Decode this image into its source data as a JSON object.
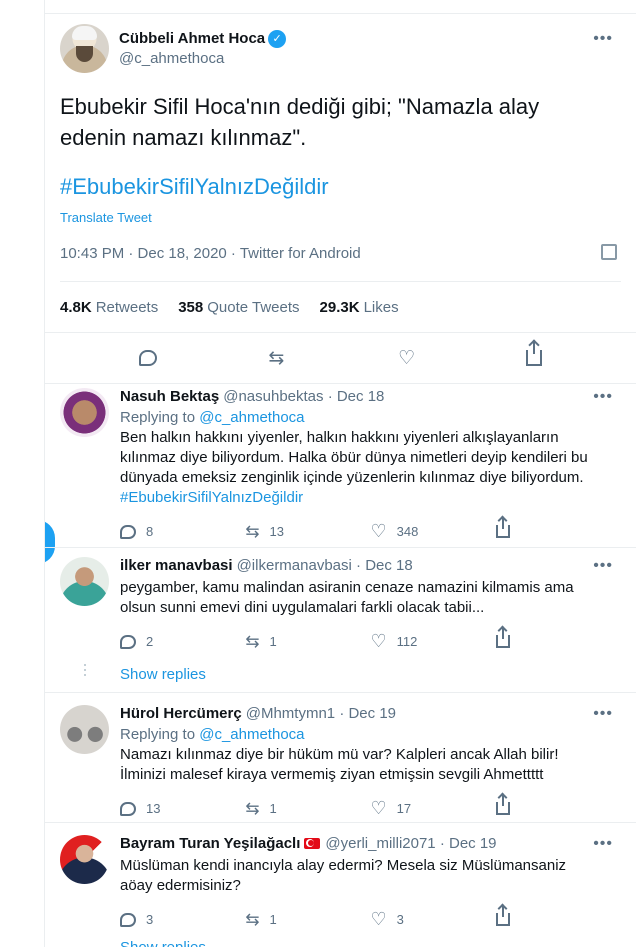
{
  "main_tweet": {
    "author_name": "Cübbeli Ahmet Hoca",
    "author_handle": "@c_ahmethoca",
    "text": "Ebubekir Sifil Hoca'nın dediği gibi; \"Namazla alay edenin namazı kılınmaz\".",
    "hashtag": "#EbubekirSifilYalnızDeğildir",
    "translate": "Translate Tweet",
    "meta": "10:43 PM · Dec 18, 2020 · Twitter for Android",
    "stats": {
      "retweets_count": "4.8K",
      "retweets_label": "Retweets",
      "quotes_count": "358",
      "quotes_label": "Quote Tweets",
      "likes_count": "29.3K",
      "likes_label": "Likes"
    }
  },
  "replies": [
    {
      "name": "Nasuh Bektaş",
      "handle": "@nasuhbektas",
      "date": "· Dec 18",
      "replying_prefix": "Replying to",
      "replying_to": "@c_ahmethoca",
      "text": "Ben halkın hakkını yiyenler, halkın hakkını yiyenleri alkışlayanların kılınmaz diye biliyordum. Halka öbür dünya nimetleri deyip kendileri bu dünyada emeksiz zenginlik içinde yüzenlerin kılınmaz diye biliyordum.",
      "hashtag": "#EbubekirSifilYalnızDeğildir",
      "replies": "8",
      "retweets": "13",
      "likes": "348"
    },
    {
      "name": "ilker manavbasi",
      "handle": "@ilkermanavbasi",
      "date": "· Dec 18",
      "text": "peygamber, kamu malindan asiranin cenaze namazini kilmamis ama olsun sunni emevi dini uygulamalari farkli olacak tabii...",
      "replies": "2",
      "retweets": "1",
      "likes": "112",
      "show_replies": "Show replies"
    },
    {
      "name": "Hürol Hercümerç",
      "handle": "@Mhmtymn1",
      "date": "· Dec 19",
      "replying_prefix": "Replying to",
      "replying_to": "@c_ahmethoca",
      "text": "Namazı kılınmaz diye bir hüküm mü var? Kalpleri ancak Allah bilir! İlminizi malesef kiraya vermemiş ziyan etmişsin sevgili Ahmettttt",
      "replies": "13",
      "retweets": "1",
      "likes": "17"
    },
    {
      "name": "Bayram Turan Yeşilağaclı",
      "handle": "@yerli_milli2071",
      "date": "· Dec 19",
      "text": "Müslüman kendi inancıyla alay edermi? Mesela siz Müslümansaniz aöay edermisiniz?",
      "replies": "3",
      "retweets": "1",
      "likes": "3"
    }
  ],
  "more_glyph": "•••",
  "bottom_show_replies": "Show replies",
  "colors": {
    "accent": "#1da1f2",
    "link": "#1b95e0",
    "muted": "#5b7083",
    "border": "#ebeef0"
  }
}
